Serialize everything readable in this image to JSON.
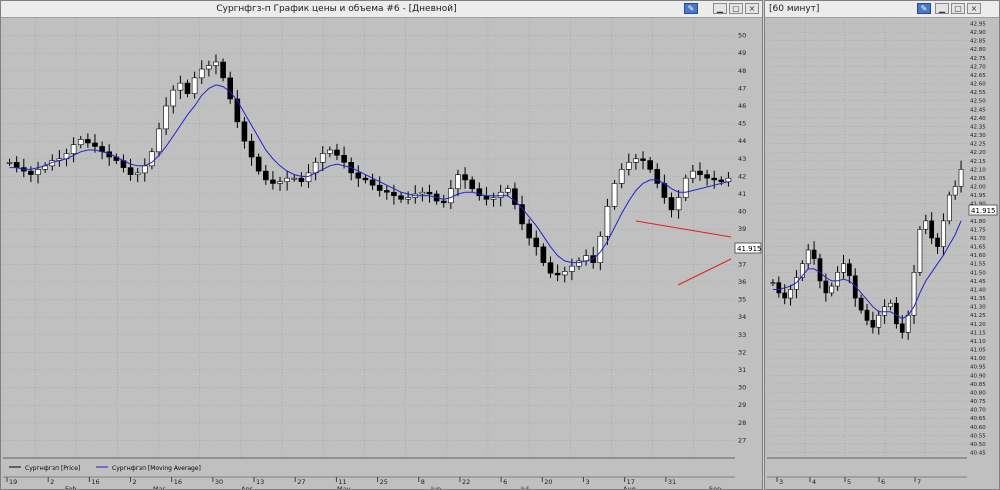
{
  "daily": {
    "title": "Сургнфгз-п График цены и объема #6 - [Дневной]",
    "legend": [
      "Сургнфгзп [Price]",
      "Сургнфгзп [Moving Average]"
    ],
    "price_label": "41.915",
    "x_top_labels": [
      "19",
      "2",
      "16",
      "2",
      "16",
      "30",
      "13",
      "27",
      "11",
      "25",
      "8",
      "22",
      "6",
      "20",
      "3",
      "17",
      "31"
    ],
    "x_month_labels": [
      "Feb",
      "Mar",
      "Apr",
      "May",
      "Jun",
      "Jul",
      "Aug",
      "Sep"
    ]
  },
  "intraday": {
    "title": "[60 минут]",
    "price_label": "41.915",
    "x_labels": [
      "3",
      "4",
      "5",
      "6",
      "7"
    ]
  },
  "colors": {
    "candle_up": "#ffffff",
    "candle_down": "#000000",
    "ma": "#2222cc",
    "trend": "#e02020",
    "grid": "#a0a0a0",
    "plot_bg": "#c0c0c0"
  },
  "chart_data": [
    {
      "type": "candlestick",
      "title": "Сургнфгз-п График цены и объема #6 - [Дневной]",
      "ylim": [
        26,
        51
      ],
      "ytick_labels": [
        "50",
        "49",
        "48",
        "47",
        "46",
        "45",
        "44",
        "43",
        "42",
        "41",
        "40",
        "39",
        "38",
        "37",
        "36",
        "35",
        "34",
        "33",
        "32",
        "31",
        "30",
        "29",
        "28",
        "27"
      ],
      "series": [
        {
          "name": "Сургнфгзп [Price]",
          "values": [
            42.8,
            42.5,
            42.3,
            42.1,
            42.4,
            42.6,
            42.9,
            43.0,
            43.3,
            43.8,
            44.1,
            43.9,
            43.7,
            43.4,
            43.1,
            42.9,
            42.5,
            42.1,
            42.2,
            42.6,
            43.4,
            44.7,
            46.0,
            46.9,
            47.3,
            46.7,
            47.6,
            48.1,
            48.3,
            48.5,
            47.6,
            46.4,
            45.1,
            44.0,
            43.1,
            42.3,
            41.8,
            41.6,
            41.7,
            41.9,
            41.9,
            41.7,
            42.2,
            42.8,
            43.3,
            43.5,
            43.2,
            42.8,
            42.2,
            41.9,
            41.8,
            41.5,
            41.2,
            41.1,
            40.9,
            40.7,
            40.8,
            41.0,
            41.1,
            41.0,
            40.6,
            40.5,
            41.3,
            42.1,
            41.8,
            41.3,
            40.9,
            40.7,
            40.8,
            41.1,
            41.3,
            40.4,
            39.3,
            38.5,
            38.0,
            37.1,
            36.5,
            36.4,
            36.6,
            36.9,
            37.2,
            37.5,
            37.1,
            38.6,
            40.3,
            41.6,
            42.4,
            42.8,
            43.0,
            42.9,
            42.4,
            41.6,
            40.8,
            40.1,
            40.8,
            41.9,
            42.3,
            42.1,
            41.9,
            41.8,
            41.7,
            41.9
          ]
        },
        {
          "name": "Сургнфгзп [Moving Average]",
          "values": [
            42.5,
            42.5,
            42.4,
            42.4,
            42.5,
            42.6,
            42.8,
            42.9,
            43.0,
            43.2,
            43.4,
            43.5,
            43.5,
            43.4,
            43.3,
            43.1,
            42.9,
            42.7,
            42.6,
            42.6,
            42.8,
            43.2,
            43.7,
            44.3,
            44.9,
            45.5,
            46.0,
            46.6,
            47.0,
            47.2,
            47.1,
            46.8,
            46.3,
            45.6,
            44.9,
            44.2,
            43.5,
            43.0,
            42.6,
            42.3,
            42.1,
            42.0,
            42.0,
            42.2,
            42.4,
            42.6,
            42.7,
            42.6,
            42.5,
            42.3,
            42.1,
            41.9,
            41.7,
            41.5,
            41.3,
            41.1,
            41.0,
            40.9,
            40.9,
            40.9,
            40.8,
            40.7,
            40.8,
            41.0,
            41.1,
            41.1,
            41.0,
            40.9,
            40.9,
            40.9,
            40.9,
            40.6,
            40.2,
            39.7,
            39.2,
            38.6,
            38.0,
            37.5,
            37.2,
            37.1,
            37.1,
            37.2,
            37.3,
            37.7,
            38.3,
            39.1,
            39.9,
            40.6,
            41.2,
            41.6,
            41.8,
            41.8,
            41.6,
            41.3,
            41.1,
            41.1,
            41.2,
            41.3,
            41.4,
            41.5,
            41.6,
            41.7
          ]
        }
      ]
    },
    {
      "type": "candlestick",
      "title": "[60 минут]",
      "ylim": [
        40.43,
        42.97
      ],
      "ytick_labels": [
        "42.95",
        "42.90",
        "42.85",
        "42.80",
        "42.75",
        "42.70",
        "42.65",
        "42.60",
        "42.55",
        "42.50",
        "42.45",
        "42.40",
        "42.35",
        "42.30",
        "42.25",
        "42.20",
        "42.15",
        "42.10",
        "42.05",
        "42.00",
        "41.95",
        "41.90",
        "41.85",
        "41.80",
        "41.75",
        "41.70",
        "41.65",
        "41.60",
        "41.55",
        "41.50",
        "41.45",
        "41.40",
        "41.35",
        "41.30",
        "41.25",
        "41.20",
        "41.15",
        "41.10",
        "41.05",
        "41.00",
        "40.95",
        "40.90",
        "40.85",
        "40.80",
        "40.75",
        "40.70",
        "40.65",
        "40.60",
        "40.55",
        "40.50",
        "40.45"
      ],
      "series": [
        {
          "name": "Сургнфгзп [Price]",
          "values": [
            41.44,
            41.38,
            41.35,
            41.4,
            41.47,
            41.55,
            41.63,
            41.58,
            41.45,
            41.38,
            41.42,
            41.5,
            41.55,
            41.48,
            41.35,
            41.28,
            41.22,
            41.18,
            41.25,
            41.3,
            41.32,
            41.2,
            41.15,
            41.25,
            41.5,
            41.75,
            41.8,
            41.7,
            41.65,
            41.8,
            41.95,
            42.0,
            42.1
          ]
        },
        {
          "name": "Сургнфгзп [Moving Average]",
          "values": [
            41.4,
            41.4,
            41.41,
            41.42,
            41.44,
            41.48,
            41.52,
            41.52,
            41.5,
            41.47,
            41.45,
            41.45,
            41.46,
            41.45,
            41.42,
            41.38,
            41.34,
            41.3,
            41.27,
            41.27,
            41.27,
            41.25,
            41.23,
            41.25,
            41.3,
            41.38,
            41.45,
            41.5,
            41.55,
            41.6,
            41.66,
            41.72,
            41.8
          ]
        }
      ]
    }
  ]
}
